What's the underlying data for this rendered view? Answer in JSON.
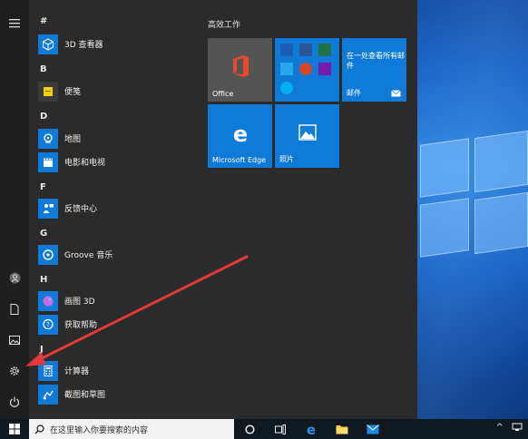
{
  "start_menu": {
    "letters": {
      "hash": "#",
      "b": "B",
      "d": "D",
      "f": "F",
      "g": "G",
      "h": "H",
      "j": "J"
    },
    "apps": {
      "viewer3d": "3D 查看器",
      "sticky": "便笺",
      "maps": "地图",
      "movies": "电影和电视",
      "feedback": "反馈中心",
      "groove": "Groove 音乐",
      "paint3d": "画图 3D",
      "gethelp": "获取帮助",
      "calculator": "计算器",
      "snip": "截图和草图"
    },
    "tiles": {
      "group_title": "高效工作",
      "office": "Office",
      "mail_top": "在一处查看所有邮件",
      "mail_label": "邮件",
      "edge": "Microsoft Edge",
      "photos": "照片"
    }
  },
  "taskbar": {
    "search_placeholder": "在这里输入你要搜索的内容"
  },
  "colors": {
    "tile_blue": "#0f7ad8",
    "office_tile": "#545454",
    "start_bg": "#2b2b2b",
    "arrow_red": "#e23a3a"
  }
}
